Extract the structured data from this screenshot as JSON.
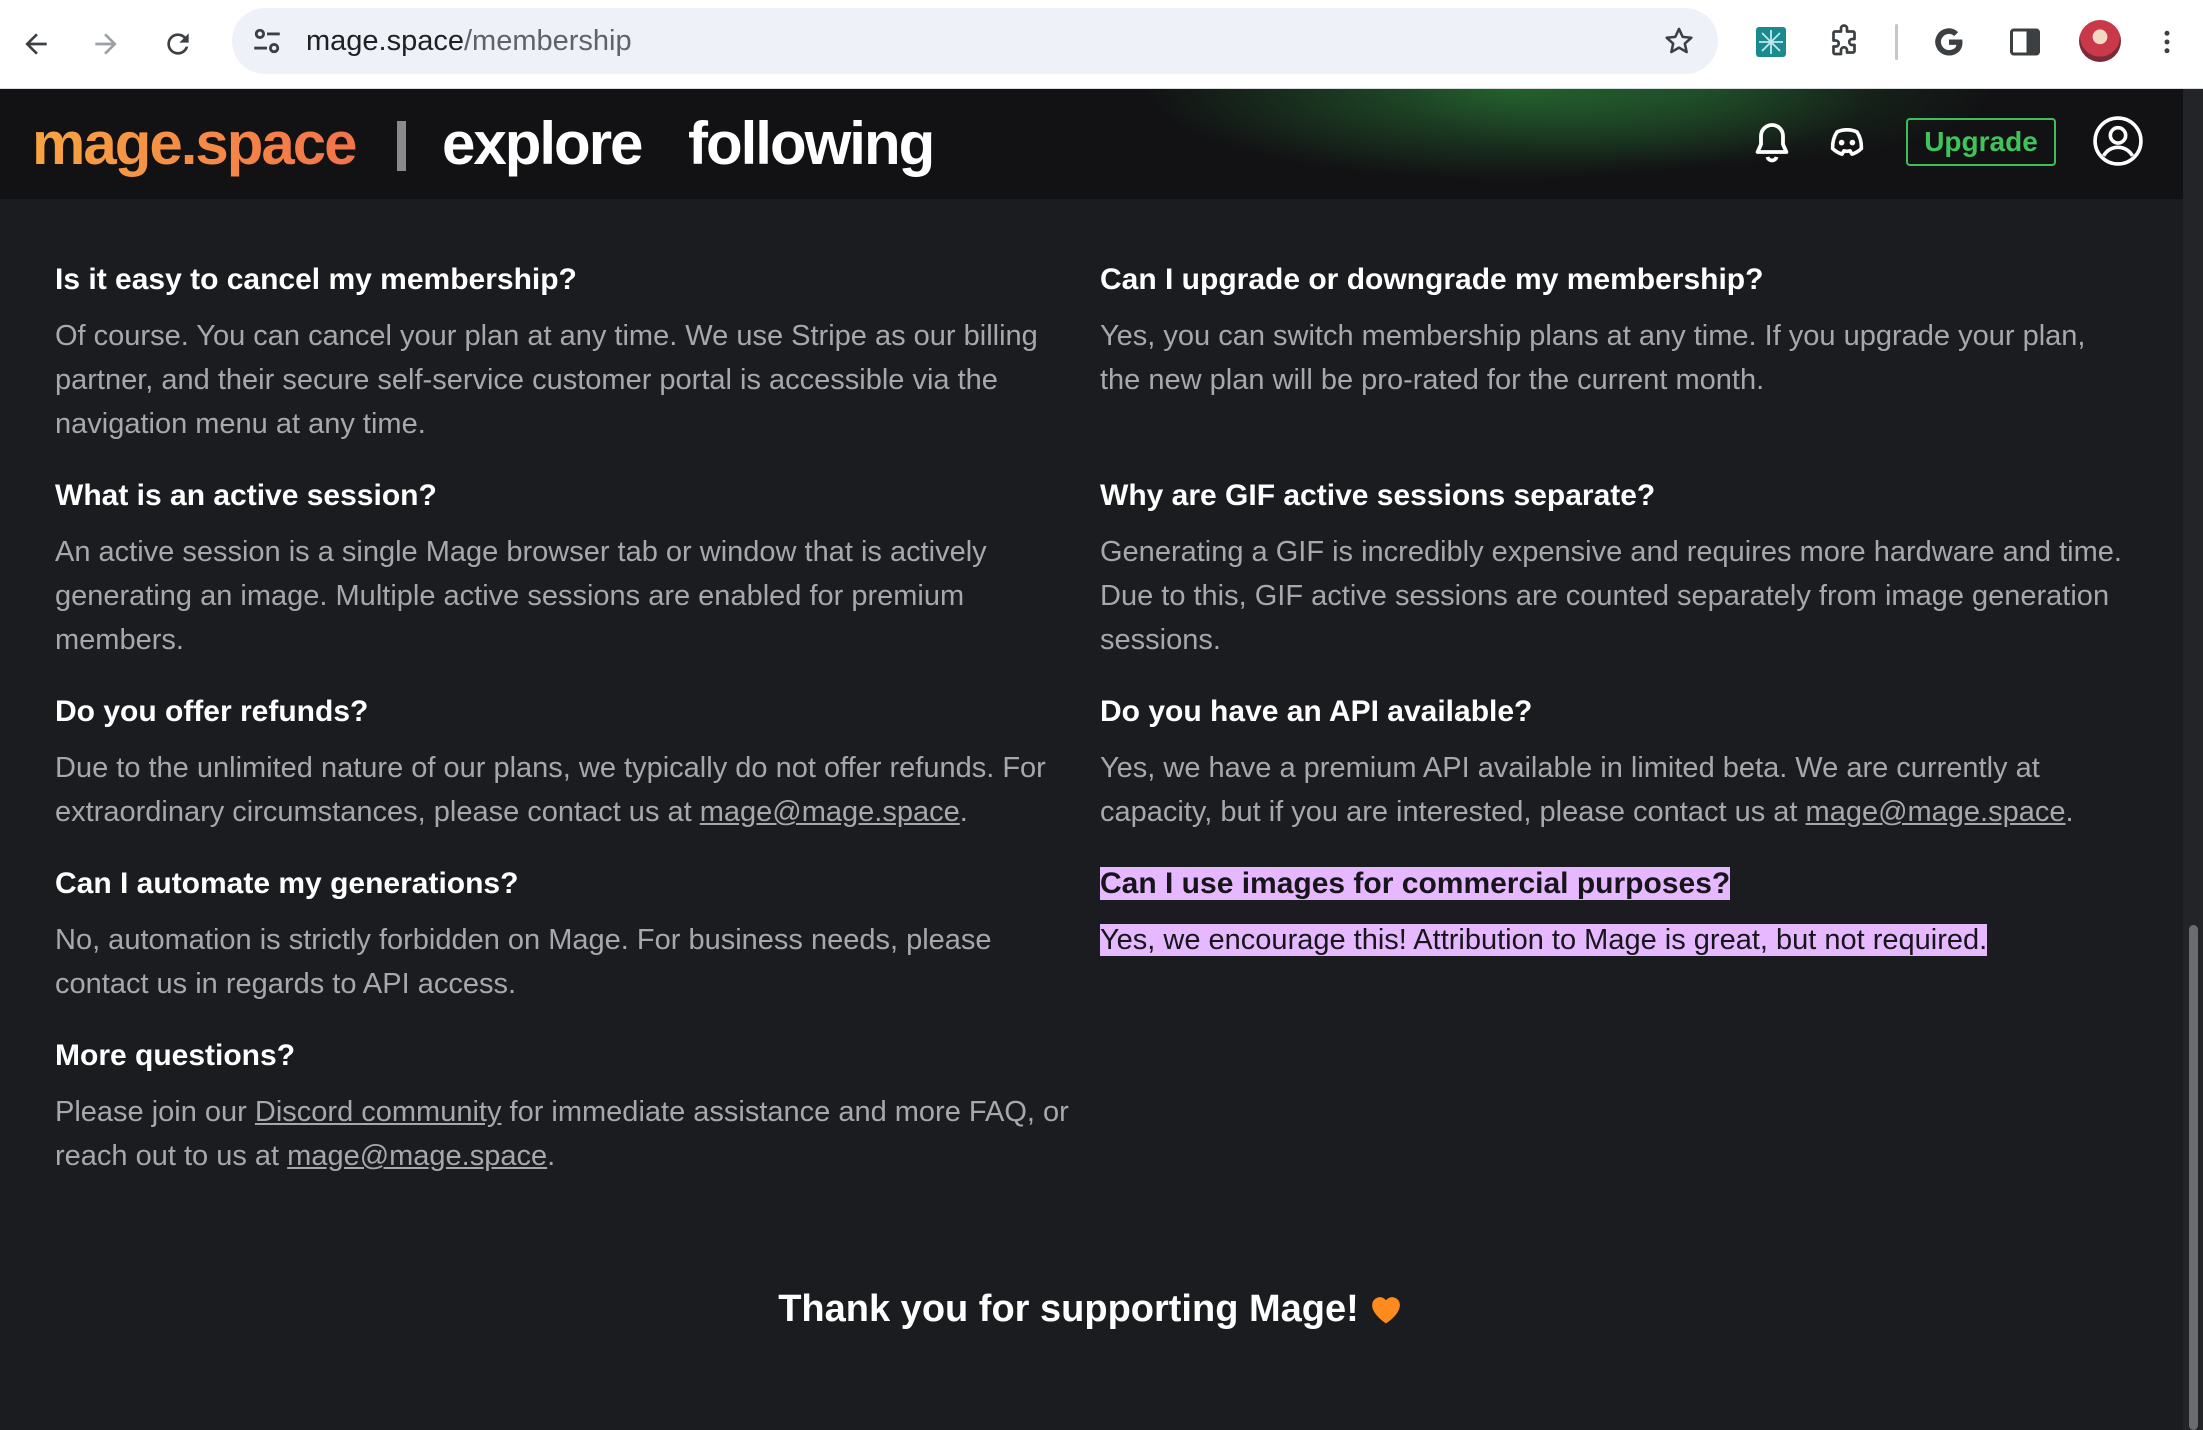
{
  "browser": {
    "url_host": "mage.space",
    "url_path": "/membership"
  },
  "header": {
    "logo": "mage.space",
    "nav": [
      "explore",
      "following"
    ],
    "upgrade_label": "Upgrade"
  },
  "faq": [
    {
      "q": "Is it easy to cancel my membership?",
      "a": "Of course. You can cancel your plan at any time. We use Stripe as our billing partner, and their secure self-service customer portal is accessible via the navigation menu at any time."
    },
    {
      "q": "Can I upgrade or downgrade my membership?",
      "a": "Yes, you can switch membership plans at any time. If you upgrade your plan, the new plan will be pro-rated for the current month."
    },
    {
      "q": "What is an active session?",
      "a": "An active session is a single Mage browser tab or window that is actively generating an image. Multiple active sessions are enabled for premium members."
    },
    {
      "q": "Why are GIF active sessions separate?",
      "a": "Generating a GIF is incredibly expensive and requires more hardware and time. Due to this, GIF active sessions are counted separately from image generation sessions."
    },
    {
      "q": "Do you offer refunds?",
      "a_pre": "Due to the unlimited nature of our plans, we typically do not offer refunds. For extraordinary circumstances, please contact us at ",
      "a_link": "mage@mage.space",
      "a_post": "."
    },
    {
      "q": "Do you have an API available?",
      "a_pre": "Yes, we have a premium API available in limited beta. We are currently at capacity, but if you are interested, please contact us at ",
      "a_link": "mage@mage.space",
      "a_post": "."
    },
    {
      "q": "Can I automate my generations?",
      "a": "No, automation is strictly forbidden on Mage. For business needs, please contact us in regards to API access."
    },
    {
      "q": "Can I use images for commercial purposes?",
      "a": "Yes, we encourage this! Attribution to Mage is great, but not required."
    },
    {
      "q": "More questions?",
      "a_pre": "Please join our ",
      "a_link1": "Discord community",
      "a_mid": " for immediate assistance and more FAQ, or reach out to us at ",
      "a_link2": "mage@mage.space",
      "a_post": "."
    }
  ],
  "footer": {
    "thanks": "Thank you for supporting Mage!"
  },
  "colors": {
    "background": "#1b1c1f",
    "logo_gradient_start": "#f7a441",
    "logo_gradient_end": "#f2734a",
    "upgrade_green": "#41c35c",
    "highlight": "#e6b8ff",
    "heart": "#ff8a1e"
  },
  "icons": [
    "back-icon",
    "forward-icon",
    "reload-icon",
    "tune-icon",
    "star-icon",
    "extension-icon",
    "puzzle-icon",
    "google-icon",
    "sidepanel-icon",
    "menu-icon",
    "bell-icon",
    "discord-icon",
    "user-circle-icon",
    "heart-icon"
  ]
}
